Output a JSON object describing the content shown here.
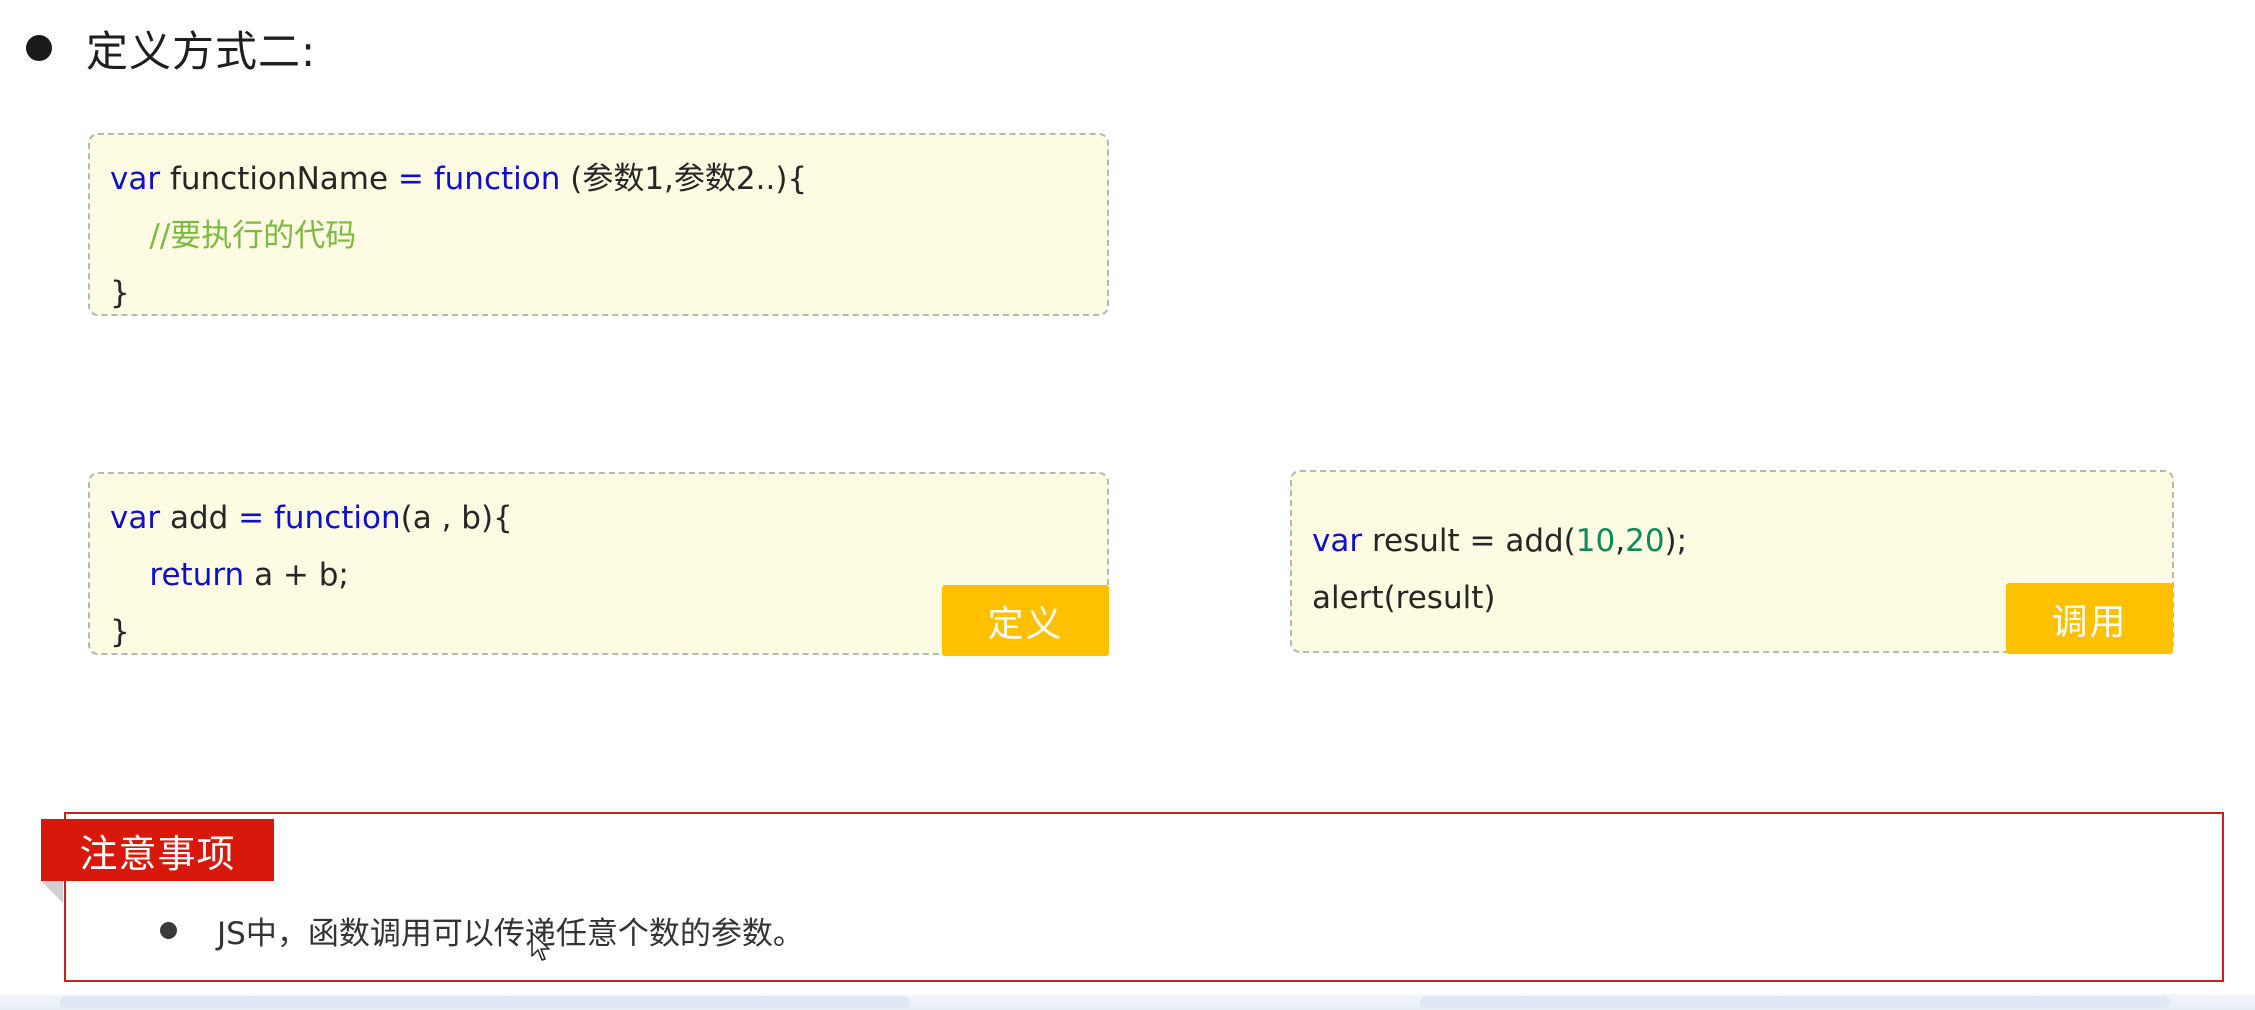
{
  "heading": {
    "text": "定义方式二:"
  },
  "syntax_block": {
    "line1": {
      "kw_var": "var",
      "name": " functionName ",
      "kw_eq_function": "= function",
      "params": " (参数1,参数2..){"
    },
    "line2": {
      "comment": "    //要执行的代码"
    },
    "line3": "}"
  },
  "example_block": {
    "line1": {
      "kw_var": "var",
      "name": " add ",
      "kw_eq_function": "= function",
      "params": "(a , b){"
    },
    "line2": {
      "indent": "    ",
      "kw_return": "return",
      "expr": " a + b;"
    },
    "line3": "}",
    "tag_label": "定义"
  },
  "call_block": {
    "line1": {
      "kw_var": "var",
      "before": " result = add(",
      "num1": "10",
      "comma": ",",
      "num2": "20",
      "after": ");"
    },
    "line2": "alert(result)",
    "tag_label": "调用"
  },
  "note": {
    "title": "注意事项",
    "items": [
      "JS中，函数调用可以传递任意个数的参数。"
    ]
  },
  "colors": {
    "keyword": "#1010c8",
    "comment": "#7cba3e",
    "number": "#0b8a5a",
    "code_bg": "#fefbe3",
    "tag_bg": "#ffc000",
    "note_red": "#d9180c"
  }
}
